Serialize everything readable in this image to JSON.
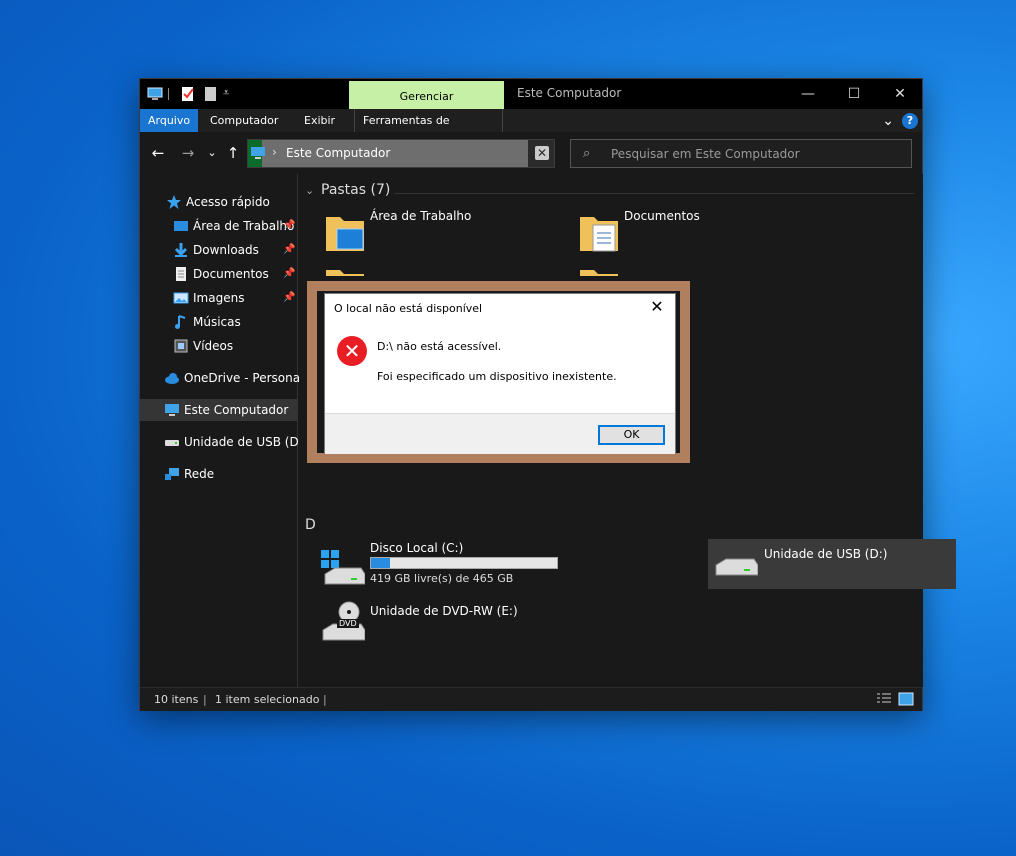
{
  "titlebar": {
    "context_tab": "Gerenciar",
    "title": "Este Computador",
    "minimize": "—",
    "maximize": "☐",
    "close": "✕"
  },
  "ribbon": {
    "tabs": [
      {
        "label": "Arquivo",
        "active": true
      },
      {
        "label": "Computador"
      },
      {
        "label": "Exibir"
      },
      {
        "label": "Ferramentas de Unidade"
      }
    ],
    "expand": "⌄",
    "help": "?"
  },
  "nav": {
    "back": "←",
    "forward": "→",
    "recent": "⌄",
    "up": "↑",
    "address_chevron": "›",
    "address": "Este Computador",
    "clear": "✕",
    "search_icon": "⌕",
    "search_placeholder": "Pesquisar em Este Computador"
  },
  "sidebar": {
    "items": [
      {
        "label": "Acesso rápido",
        "icon": "star-icon"
      },
      {
        "label": "Área de Trabalho",
        "icon": "desktop-icon",
        "pinned": true
      },
      {
        "label": "Downloads",
        "icon": "download-icon",
        "pinned": true
      },
      {
        "label": "Documentos",
        "icon": "document-icon",
        "pinned": true
      },
      {
        "label": "Imagens",
        "icon": "picture-icon",
        "pinned": true
      },
      {
        "label": "Músicas",
        "icon": "music-icon"
      },
      {
        "label": "Vídeos",
        "icon": "video-icon"
      },
      {
        "label": "OneDrive - Personal",
        "icon": "cloud-icon"
      },
      {
        "label": "Este Computador",
        "icon": "computer-icon",
        "selected": true
      },
      {
        "label": "Unidade de USB (D:)",
        "icon": "usb-drive-icon"
      },
      {
        "label": "Rede",
        "icon": "network-icon"
      }
    ],
    "pin_glyph": "📌"
  },
  "content": {
    "folders_group": "Pastas (7)",
    "group_chevron": "⌄",
    "folders": [
      {
        "label": "Área de Trabalho"
      },
      {
        "label": "Documentos"
      }
    ],
    "devices_group_letter": "D",
    "drives": [
      {
        "label": "Disco Local (C:)",
        "free": "419 GB livre(s) de 465 GB",
        "used_fraction": 0.1
      },
      {
        "label": "Unidade de USB (D:)"
      },
      {
        "label": "Unidade de DVD-RW (E:)",
        "badge": "DVD"
      }
    ]
  },
  "status": {
    "items": "10 itens",
    "selected": "1 item selecionado"
  },
  "dialog": {
    "title": "O local não está disponível",
    "close": "✕",
    "message": "D:\\ não está acessível.",
    "detail": "Foi especificado um dispositivo inexistente.",
    "ok": "OK",
    "error_glyph": "✕"
  },
  "colors": {
    "accent": "#1a75d1",
    "context_tab": "#c6f0a6",
    "error": "#e81e24",
    "frame": "#b07f5d"
  }
}
